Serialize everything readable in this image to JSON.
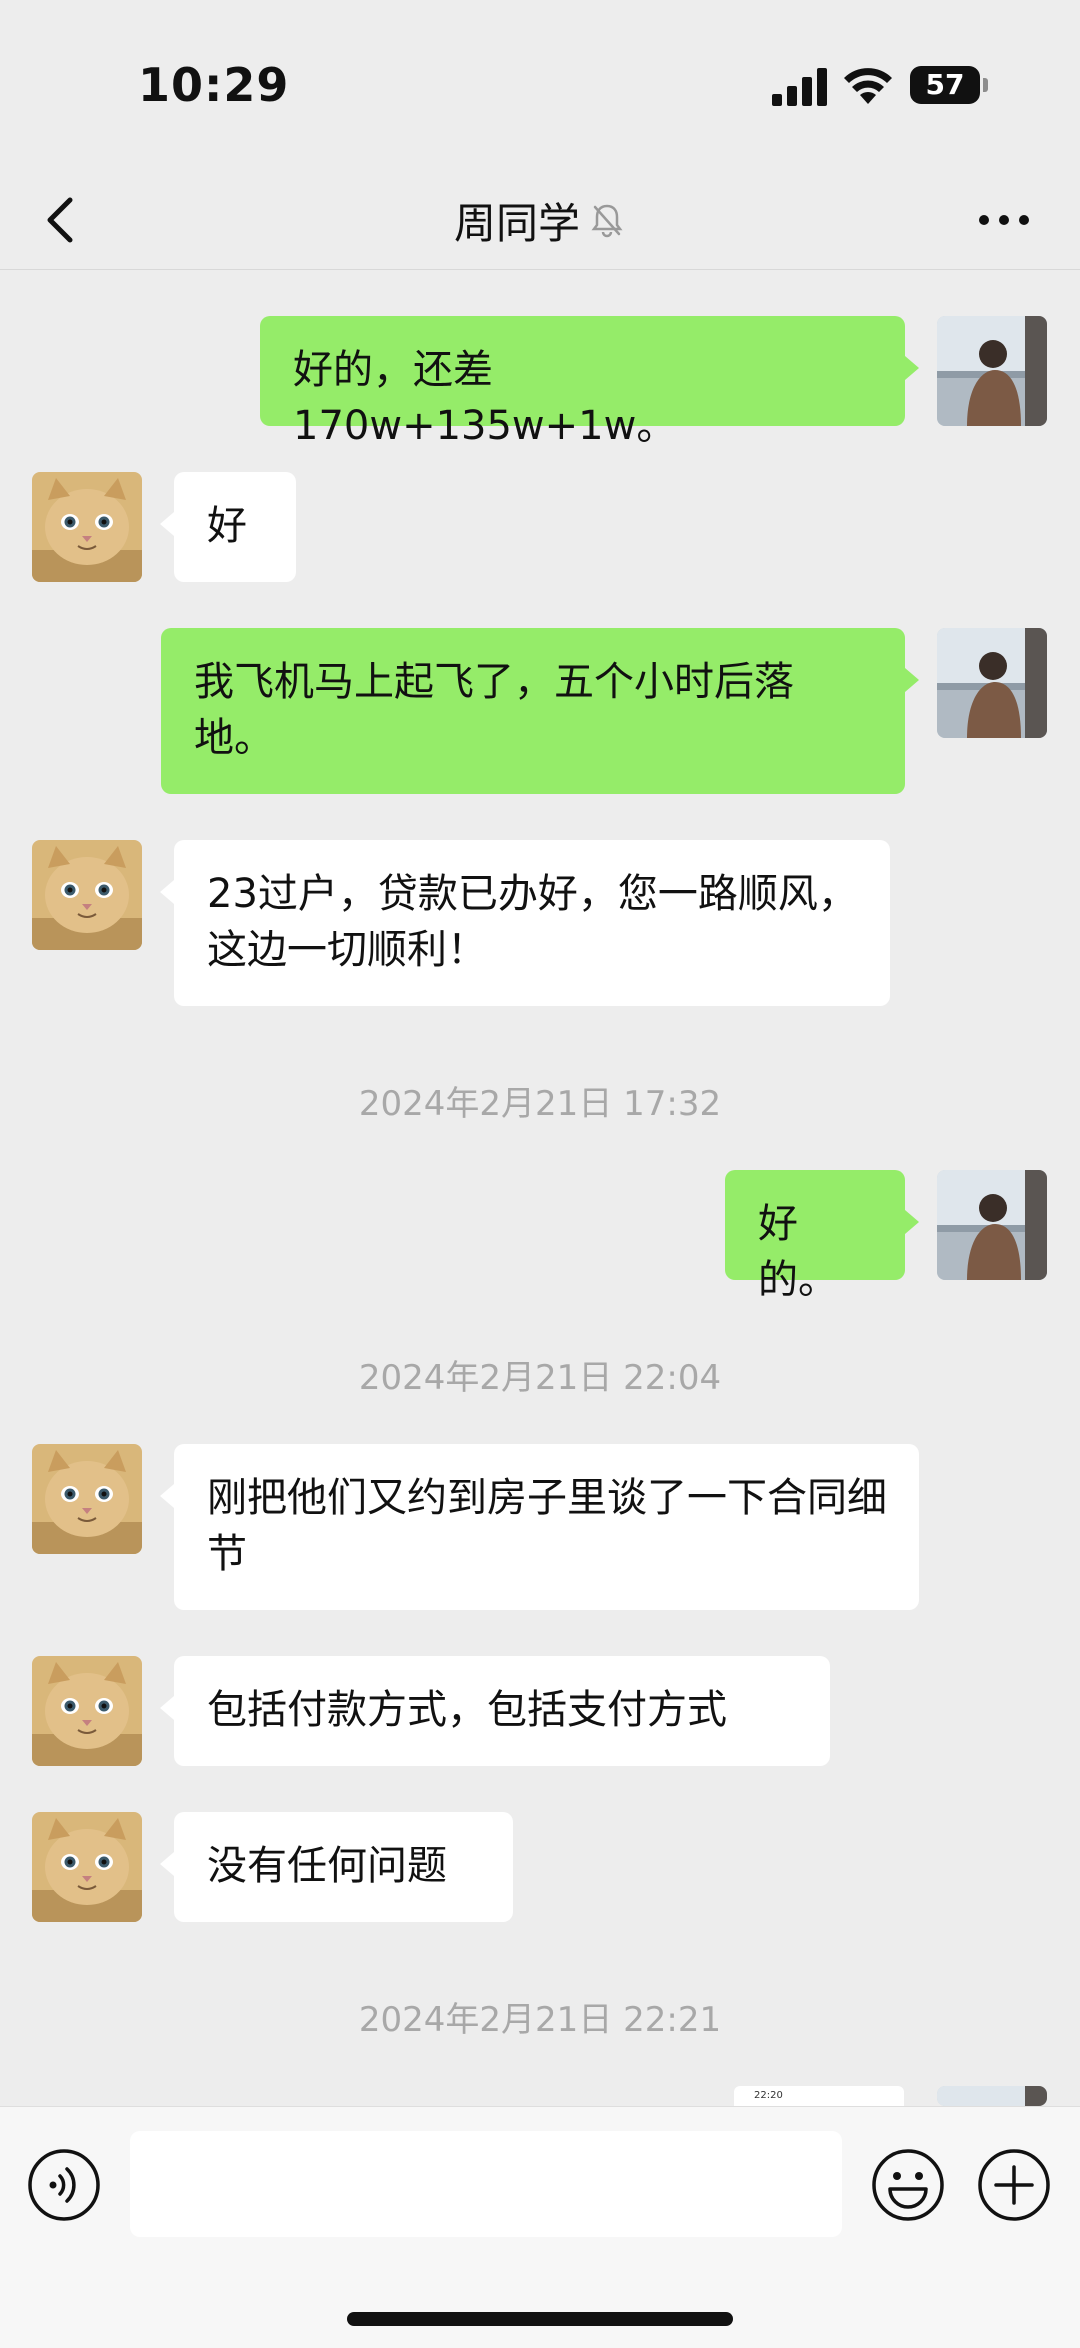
{
  "status_bar": {
    "time": "10:29",
    "battery": "57"
  },
  "header": {
    "title": "周同学"
  },
  "messages": [
    {
      "from": "me",
      "text": "好的，还差170w+135w+1w。"
    },
    {
      "from": "other",
      "text": "好"
    },
    {
      "from": "me",
      "text": "我飞机马上起飞了，五个小时后落地。"
    },
    {
      "from": "other",
      "text": "23过户，贷款已办好，您一路顺风，这边一切顺利！"
    },
    {
      "type": "timestamp",
      "text": "2024年2月21日 17:32"
    },
    {
      "from": "me",
      "text": "好的。"
    },
    {
      "type": "timestamp",
      "text": "2024年2月21日 22:04"
    },
    {
      "from": "other",
      "text": "刚把他们又约到房子里谈了一下合同细节"
    },
    {
      "from": "other",
      "text": "包括付款方式，包括支付方式"
    },
    {
      "from": "other",
      "text": "没有任何问题"
    },
    {
      "type": "timestamp",
      "text": "2024年2月21日 22:21"
    }
  ],
  "image_preview": {
    "time": "22:20"
  },
  "input": {
    "value": "",
    "placeholder": ""
  },
  "icons": {
    "back": "chevron-left-icon",
    "mute": "bell-slash-icon",
    "more": "ellipsis-icon",
    "voice": "voice-icon",
    "emoji": "smiley-icon",
    "plus": "plus-circle-icon"
  },
  "colors": {
    "my_bubble": "#95ec69",
    "other_bubble": "#ffffff",
    "background": "#ededed"
  }
}
